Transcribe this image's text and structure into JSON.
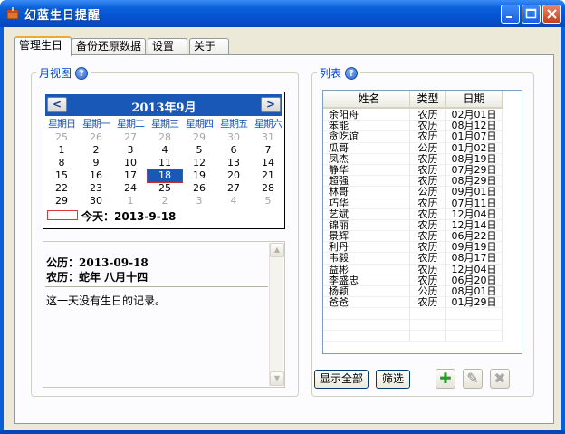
{
  "window": {
    "title": "幻蓝生日提醒"
  },
  "tabs": [
    {
      "label": "管理生日",
      "active": true
    },
    {
      "label": "备份还原数据",
      "active": false
    },
    {
      "label": "设置",
      "active": false
    },
    {
      "label": "关于",
      "active": false
    }
  ],
  "month_view": {
    "group_title": "月视图",
    "month_label": "2013年9月",
    "prev": "<",
    "next": ">",
    "weekdays": [
      "星期日",
      "星期一",
      "星期二",
      "星期三",
      "星期四",
      "星期五",
      "星期六"
    ],
    "weeks": [
      [
        {
          "d": "25",
          "dim": true
        },
        {
          "d": "26",
          "dim": true
        },
        {
          "d": "27",
          "dim": true
        },
        {
          "d": "28",
          "dim": true
        },
        {
          "d": "29",
          "dim": true
        },
        {
          "d": "30",
          "dim": true
        },
        {
          "d": "31",
          "dim": true
        }
      ],
      [
        {
          "d": "1"
        },
        {
          "d": "2"
        },
        {
          "d": "3"
        },
        {
          "d": "4"
        },
        {
          "d": "5"
        },
        {
          "d": "6"
        },
        {
          "d": "7"
        }
      ],
      [
        {
          "d": "8"
        },
        {
          "d": "9"
        },
        {
          "d": "10"
        },
        {
          "d": "11"
        },
        {
          "d": "12"
        },
        {
          "d": "13"
        },
        {
          "d": "14"
        }
      ],
      [
        {
          "d": "15"
        },
        {
          "d": "16"
        },
        {
          "d": "17"
        },
        {
          "d": "18",
          "sel": true
        },
        {
          "d": "19"
        },
        {
          "d": "20"
        },
        {
          "d": "21"
        }
      ],
      [
        {
          "d": "22"
        },
        {
          "d": "23"
        },
        {
          "d": "24"
        },
        {
          "d": "25"
        },
        {
          "d": "26"
        },
        {
          "d": "27"
        },
        {
          "d": "28"
        }
      ],
      [
        {
          "d": "29"
        },
        {
          "d": "30"
        },
        {
          "d": "1",
          "dim": true
        },
        {
          "d": "2",
          "dim": true
        },
        {
          "d": "3",
          "dim": true
        },
        {
          "d": "4",
          "dim": true
        },
        {
          "d": "5",
          "dim": true
        }
      ]
    ],
    "today_label": "今天：2013-9-18"
  },
  "day_info": {
    "solar": "公历：2013-09-18",
    "lunar": "农历：蛇年  八月十四",
    "message": "这一天没有生日的记录。"
  },
  "list": {
    "group_title": "列表",
    "columns": [
      "姓名",
      "类型",
      "日期"
    ],
    "rows": [
      [
        "余阳舟",
        "农历",
        "02月01日"
      ],
      [
        "笨能",
        "农历",
        "08月12日"
      ],
      [
        "贪吃谊",
        "农历",
        "01月07日"
      ],
      [
        "瓜哥",
        "公历",
        "01月02日"
      ],
      [
        "凤杰",
        "农历",
        "08月19日"
      ],
      [
        "静华",
        "农历",
        "07月29日"
      ],
      [
        "超强",
        "农历",
        "08月29日"
      ],
      [
        "林哥",
        "公历",
        "09月01日"
      ],
      [
        "巧华",
        "农历",
        "07月11日"
      ],
      [
        "艺斌",
        "农历",
        "12月04日"
      ],
      [
        "锦丽",
        "农历",
        "12月14日"
      ],
      [
        "景辉",
        "农历",
        "06月22日"
      ],
      [
        "利丹",
        "农历",
        "09月19日"
      ],
      [
        "韦毅",
        "农历",
        "08月17日"
      ],
      [
        "益彬",
        "农历",
        "12月04日"
      ],
      [
        "李盛忠",
        "农历",
        "06月20日"
      ],
      [
        "杨颖",
        "公历",
        "08月01日"
      ],
      [
        "爸爸",
        "农历",
        "01月29日"
      ]
    ],
    "show_all": "显示全部",
    "filter": "筛选"
  }
}
